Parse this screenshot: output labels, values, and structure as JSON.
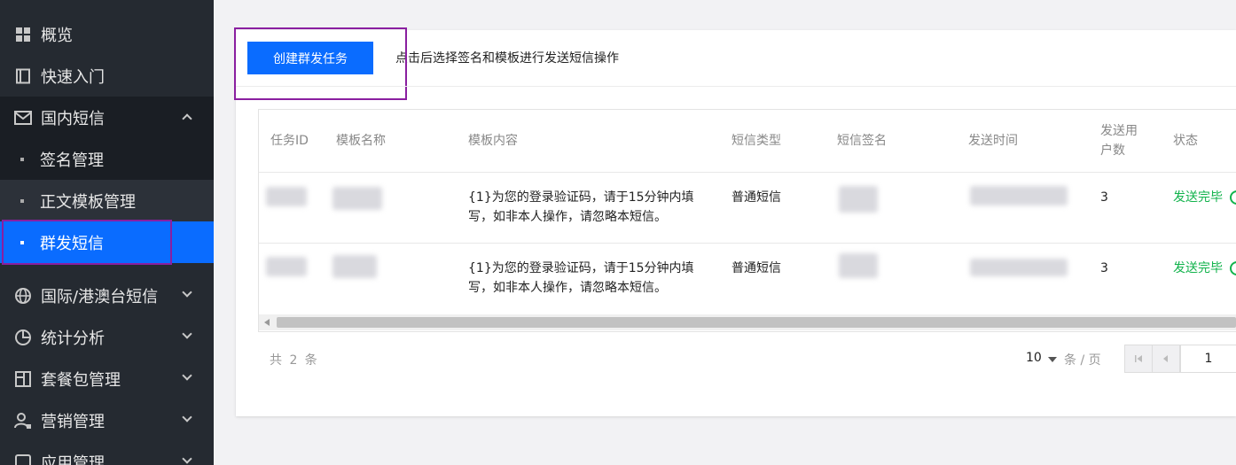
{
  "sidebar": {
    "items": [
      {
        "label": "概览",
        "icon": "grid-icon"
      },
      {
        "label": "快速入门",
        "icon": "book-icon"
      },
      {
        "label": "国内短信",
        "icon": "mail-icon"
      },
      {
        "label": "国际/港澳台短信",
        "icon": "globe-icon"
      },
      {
        "label": "统计分析",
        "icon": "pie-chart-icon"
      },
      {
        "label": "套餐包管理",
        "icon": "package-icon"
      },
      {
        "label": "营销管理",
        "icon": "users-icon"
      },
      {
        "label": "应用管理",
        "icon": "app-icon"
      }
    ],
    "subitems": [
      {
        "label": "签名管理"
      },
      {
        "label": "正文模板管理"
      },
      {
        "label": "群发短信"
      }
    ]
  },
  "toolbar": {
    "create_label": "创建群发任务",
    "hint": "点击后选择签名和模板进行发送短信操作"
  },
  "table": {
    "headers": {
      "task_id": "任务ID",
      "template_name": "模板名称",
      "template_content": "模板内容",
      "sms_type": "短信类型",
      "signature": "短信签名",
      "send_time": "发送时间",
      "users_line1": "发送用",
      "users_line2": "户数",
      "status": "状态"
    },
    "rows": [
      {
        "content_line1": "{1}为您的登录验证码，请于15分钟内填",
        "content_line2": "写，如非本人操作，请忽略本短信。",
        "sms_type": "普通短信",
        "users": "3",
        "status": "发送完毕"
      },
      {
        "content_line1": "{1}为您的登录验证码，请于15分钟内填",
        "content_line2": "写，如非本人操作，请忽略本短信。",
        "sms_type": "普通短信",
        "users": "3",
        "status": "发送完毕"
      }
    ]
  },
  "pagination": {
    "total": "共 2 条",
    "page_size": "10",
    "per_page": "条 / 页",
    "current_page": "1"
  },
  "colors": {
    "accent": "#0a6cff",
    "sidebar_bg": "#252a31",
    "status_success": "#12b34c",
    "annotation_box": "#8a1fa0"
  }
}
